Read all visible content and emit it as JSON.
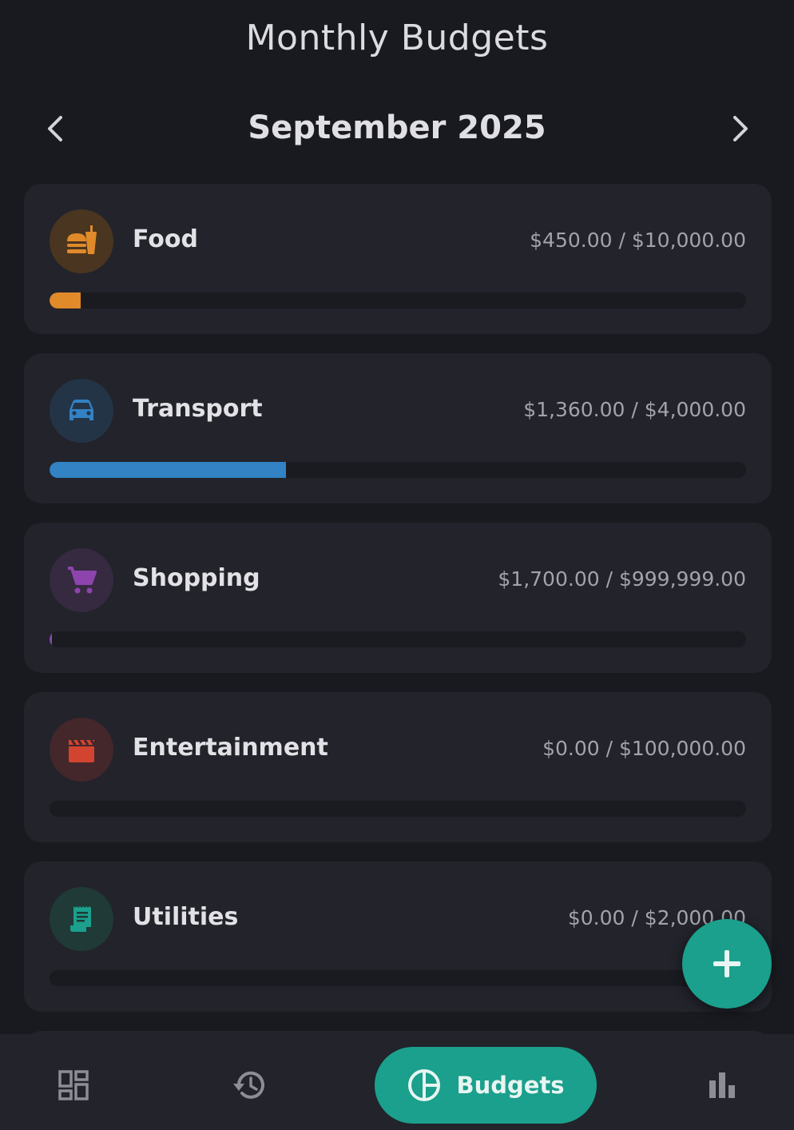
{
  "header": {
    "title": "Monthly Budgets"
  },
  "month_nav": {
    "label": "September 2025",
    "prev_icon": "chevron-left-icon",
    "next_icon": "chevron-right-icon"
  },
  "budgets": [
    {
      "name": "Food",
      "amount": "$450.00 / $10,000.00",
      "icon": "fastfood-icon",
      "color": "#e08a2a",
      "icon_bg": "#4a3520",
      "progress": 0.045
    },
    {
      "name": "Transport",
      "amount": "$1,360.00 / $4,000.00",
      "icon": "car-icon",
      "color": "#3282c4",
      "icon_bg": "#243447",
      "progress": 0.34
    },
    {
      "name": "Shopping",
      "amount": "$1,700.00 / $999,999.00",
      "icon": "shopping-cart-icon",
      "color": "#8e44ad",
      "icon_bg": "#352a40",
      "progress": 0.0017
    },
    {
      "name": "Entertainment",
      "amount": "$0.00 / $100,000.00",
      "icon": "movie-clapper-icon",
      "color": "#d2442f",
      "icon_bg": "#43272a",
      "progress": 0
    },
    {
      "name": "Utilities",
      "amount": "$0.00 / $2,000.00",
      "icon": "receipt-icon",
      "color": "#1aa08c",
      "icon_bg": "#1f3a37",
      "progress": 0
    }
  ],
  "fab": {
    "icon": "plus-icon"
  },
  "bottom_nav": {
    "items": [
      {
        "id": "dashboard",
        "icon": "dashboard-icon",
        "label": ""
      },
      {
        "id": "history",
        "icon": "history-icon",
        "label": ""
      },
      {
        "id": "budgets",
        "icon": "pie-chart-icon",
        "label": "Budgets"
      },
      {
        "id": "stats",
        "icon": "bar-chart-icon",
        "label": ""
      }
    ],
    "active_color": "#1aa08c"
  }
}
